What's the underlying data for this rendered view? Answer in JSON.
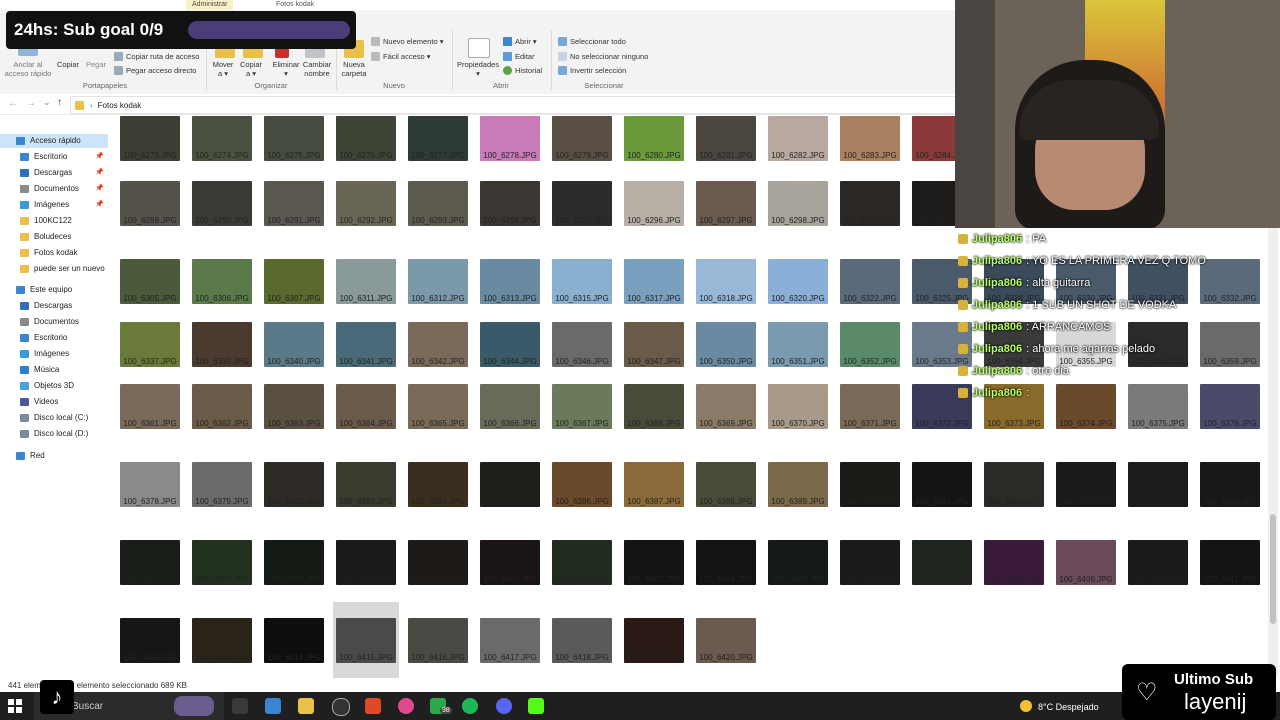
{
  "ribbon": {
    "tabs": [
      "Administrar",
      "Fotos kodak"
    ],
    "groups": {
      "portapapeles": "Portapapeles",
      "organizar": "Organizar",
      "nuevo": "Nuevo",
      "abrir": "Abrir",
      "seleccionar": "Seleccionar"
    },
    "buttons": {
      "anclar": [
        "Anclar al",
        "acceso rápido"
      ],
      "copiar": "Copiar",
      "pegar": "Pegar",
      "copiar_ruta": "Copiar ruta de acceso",
      "pegar_acceso": "Pegar acceso directo",
      "mover": [
        "Mover",
        "a ▾"
      ],
      "copiar_a": [
        "Copiar",
        "a ▾"
      ],
      "eliminar": [
        "Eliminar",
        "▾"
      ],
      "cambiar_nombre": [
        "Cambiar",
        "nombre"
      ],
      "nueva_carpeta": [
        "Nueva",
        "carpeta"
      ],
      "nuevo_elemento": "Nuevo elemento ▾",
      "facil_acceso": "Fácil acceso ▾",
      "propiedades": [
        "Propiedades",
        "▾"
      ],
      "abrir": "Abrir ▾",
      "editar": "Editar",
      "historial": "Historial",
      "seleccionar_todo": "Seleccionar todo",
      "no_seleccionar": "No seleccionar ninguno",
      "invertir": "Invertir selección"
    }
  },
  "address": {
    "path": "Fotos kodak"
  },
  "nav": {
    "items": [
      {
        "label": "Acceso rápido",
        "icon": "star-icon",
        "color": "#3a86d1",
        "level": 0,
        "selected": true,
        "pinned": false
      },
      {
        "label": "Escritorio",
        "icon": "desktop-icon",
        "color": "#3a86d1",
        "level": 1,
        "selected": false,
        "pinned": true
      },
      {
        "label": "Descargas",
        "icon": "download-icon",
        "color": "#2f6fbf",
        "level": 1,
        "selected": false,
        "pinned": true
      },
      {
        "label": "Documentos",
        "icon": "documents-icon",
        "color": "#8a8a8a",
        "level": 1,
        "selected": false,
        "pinned": true
      },
      {
        "label": "Imágenes",
        "icon": "pictures-icon",
        "color": "#3a9ad9",
        "level": 1,
        "selected": false,
        "pinned": true
      },
      {
        "label": "100KC122",
        "icon": "folder-icon",
        "color": "#e8c04a",
        "level": 1,
        "selected": false,
        "pinned": false
      },
      {
        "label": "Boludeces",
        "icon": "folder-icon",
        "color": "#e8c04a",
        "level": 1,
        "selected": false,
        "pinned": false
      },
      {
        "label": "Fotos kodak",
        "icon": "folder-icon",
        "color": "#e8c04a",
        "level": 1,
        "selected": false,
        "pinned": false
      },
      {
        "label": "puede ser un nuevo",
        "icon": "folder-icon",
        "color": "#e8c04a",
        "level": 1,
        "selected": false,
        "pinned": false
      },
      {
        "label": "Este equipo",
        "icon": "computer-icon",
        "color": "#3a86d1",
        "level": 0,
        "selected": false,
        "pinned": false
      },
      {
        "label": "Descargas",
        "icon": "download-icon",
        "color": "#2f6fbf",
        "level": 1,
        "selected": false,
        "pinned": false
      },
      {
        "label": "Documentos",
        "icon": "documents-icon",
        "color": "#8a8a8a",
        "level": 1,
        "selected": false,
        "pinned": false
      },
      {
        "label": "Escritorio",
        "icon": "desktop-icon",
        "color": "#3a86d1",
        "level": 1,
        "selected": false,
        "pinned": false
      },
      {
        "label": "Imágenes",
        "icon": "pictures-icon",
        "color": "#3a9ad9",
        "level": 1,
        "selected": false,
        "pinned": false
      },
      {
        "label": "Música",
        "icon": "music-icon",
        "color": "#2f7fd0",
        "level": 1,
        "selected": false,
        "pinned": false
      },
      {
        "label": "Objetos 3D",
        "icon": "3d-objects-icon",
        "color": "#4aa3df",
        "level": 1,
        "selected": false,
        "pinned": false
      },
      {
        "label": "Videos",
        "icon": "videos-icon",
        "color": "#4b5a9a",
        "level": 1,
        "selected": false,
        "pinned": false
      },
      {
        "label": "Disco local (C:)",
        "icon": "drive-icon",
        "color": "#7a8a9a",
        "level": 1,
        "selected": false,
        "pinned": false
      },
      {
        "label": "Disco local (D:)",
        "icon": "drive-icon",
        "color": "#7a8a9a",
        "level": 1,
        "selected": false,
        "pinned": false
      },
      {
        "label": "Red",
        "icon": "network-icon",
        "color": "#3a86d1",
        "level": 0,
        "selected": false,
        "pinned": false
      }
    ]
  },
  "files": {
    "rows": [
      [
        "100_6273.JPG",
        "100_6274.JPG",
        "100_6275.JPG",
        "100_6276.JPG",
        "100_6277.JPG",
        "100_6278.JPG",
        "100_6279.JPG",
        "100_6280.JPG",
        "100_6281.JPG",
        "100_6282.JPG",
        "100_6283.JPG",
        "100_6284.JPG"
      ],
      [
        "100_6289.JPG",
        "100_6290.JPG",
        "100_6291.JPG",
        "100_6292.JPG",
        "100_6293.JPG",
        "100_6294.JPG",
        "100_6295.JPG",
        "100_6296.JPG",
        "100_6297.JPG",
        "100_6298.JPG",
        "100_6299.JPG",
        "100_6300.JPG",
        "100_6301.JPG",
        "100_6302.JPG",
        "100_6303.JPG",
        "100_6304.JPG"
      ],
      [
        "100_6305.JPG",
        "100_6306.JPG",
        "100_6307.JPG",
        "100_6311.JPG",
        "100_6312.JPG",
        "100_6313.JPG",
        "100_6315.JPG",
        "100_6317.JPG",
        "100_6318.JPG",
        "100_6320.JPG",
        "100_6322.JPG",
        "100_6325.JPG",
        "100_6328.JPG",
        "100_6330.JPG",
        "100_6331.JPG",
        "100_6332.JPG"
      ],
      [
        "100_6337.JPG",
        "100_6339.JPG",
        "100_6340.JPG",
        "100_6341.JPG",
        "100_6342.JPG",
        "100_6344.JPG",
        "100_6346.JPG",
        "100_6347.JPG",
        "100_6350.JPG",
        "100_6351.JPG",
        "100_6352.JPG",
        "100_6353.JPG",
        "100_6354.JPG",
        "100_6355.JPG",
        "100_6356.JPG",
        "100_6359.JPG"
      ],
      [
        "100_6361.JPG",
        "100_6362.JPG",
        "100_6363.JPG",
        "100_6364.JPG",
        "100_6365.JPG",
        "100_6366.JPG",
        "100_6367.JPG",
        "100_6368.JPG",
        "100_6369.JPG",
        "100_6370.JPG",
        "100_6371.JPG",
        "100_6372.JPG",
        "100_6373.JPG",
        "100_6374.JPG",
        "100_6375.JPG",
        "100_6376.JPG"
      ],
      [
        "100_6378.JPG",
        "100_6379.JPG",
        "100_6382.JPG",
        "100_6383.JPG",
        "100_6384.JPG",
        "100_6385.JPG",
        "100_6386.JPG",
        "100_6387.JPG",
        "100_6388.JPG",
        "100_6389.JPG",
        "100_6390.JPG",
        "100_6391.JPG",
        "100_6392.JPG",
        "100_6393.JPG",
        "100_6394.JPG",
        "100_6395.JPG"
      ],
      [
        "100_6396.JPG",
        "100_6397.JPG",
        "100_6398.JPG",
        "100_6399.JPG",
        "100_6400.JPG",
        "100_6401.JPG",
        "100_6402.JPG",
        "100_6403.JPG",
        "100_6404.JPG",
        "100_6405.JPG",
        "100_6406.JPG",
        "100_6407.JPG",
        "100_6408.JPG",
        "100_6409.JPG",
        "100_6410.JPG",
        "100_6411.JPG"
      ],
      [
        "100_6412.JPG",
        "100_6413.JPG",
        "100_6414.JPG",
        "100_6415.JPG",
        "100_6416.JPG",
        "100_6417.JPG",
        "100_6418.JPG",
        "100_6419.JPG",
        "100_6420.JPG"
      ]
    ],
    "thumb_colors": [
      [
        "#3c3f34",
        "#4a5140",
        "#454b3e",
        "#3e4536",
        "#2e3a36",
        "#c97ab9",
        "#5a4f44",
        "#6a9a3a",
        "#4b4740",
        "#b9a8a0",
        "#a88060",
        "#8a3a3a"
      ],
      [
        "#54524a",
        "#3b3a36",
        "#5a5850",
        "#6a6656",
        "#5c5a4e",
        "#3a3632",
        "#2e2c2a",
        "#b8b0a6",
        "#6a5a50",
        "#a8a49c",
        "#2a2724",
        "#1e1c1a",
        "#20201e",
        "#2c2a28",
        "#2a2826",
        "#262422"
      ],
      [
        "#4a5a3a",
        "#5a7a4a",
        "#5a6a2e",
        "#8a9a9a",
        "#7a9aaa",
        "#6a8aa2",
        "#8ab0d0",
        "#7aa0c0",
        "#98b8d8",
        "#8ab0d8",
        "#5a6a7a",
        "#4a5a6a",
        "#3a4a5a",
        "#4a5a6a",
        "#405060",
        "#5a6a7a"
      ],
      [
        "#6a7a3a",
        "#4a3a30",
        "#5a7a8a",
        "#4a6a7a",
        "#7a6a5a",
        "#3a5a6a",
        "#6a6a6a",
        "#6a5a4a",
        "#6a8aa2",
        "#7a9ab0",
        "#5a8a6a",
        "#6a7a8a",
        "#3a3a3a",
        "#d8d8d8",
        "#2a2a2a",
        "#6a6a6a"
      ],
      [
        "#7a6a5a",
        "#6a5a48",
        "#5a5040",
        "#6a5a4a",
        "#7a6a58",
        "#6a6a5a",
        "#6a7a5a",
        "#4a4a3a",
        "#8a7a68",
        "#a89a88",
        "#7a6a58",
        "#3a3a5a",
        "#8a6a2a",
        "#6a4a2a",
        "#7a7a7a",
        "#4a4a6a"
      ],
      [
        "#8a8a88",
        "#6a6a6a",
        "#2e2a26",
        "#3a3a2e",
        "#3a2e1e",
        "#1e1e1a",
        "#6a4a2a",
        "#8a6a3a",
        "#4a4a3a",
        "#7a6a4a",
        "#1a1a16",
        "#141412",
        "#2a2a26",
        "#1a1a18",
        "#1c1c1a",
        "#181816"
      ],
      [
        "#1a1e18",
        "#22301e",
        "#141a14",
        "#1a1a1a",
        "#1e1a18",
        "#1a1416",
        "#202a1e",
        "#161412",
        "#141214",
        "#141818",
        "#1c1a18",
        "#1e241e",
        "#3a1a3a",
        "#6a4a5a",
        "#1a1a1a",
        "#141414"
      ],
      [
        "#161616",
        "#2a2418",
        "#0e0e0e",
        "#4a4a48",
        "#4a4a44",
        "#6a6a6a",
        "#5a5a5a",
        "#2a1a16",
        "#6a5a50"
      ]
    ],
    "selected": "100_6415.JPG"
  },
  "status": {
    "count": "441 elementos",
    "selection": "1 elemento seleccionado  689 KB"
  },
  "taskbar": {
    "search": "Buscar",
    "weather": "8°C  Despejado",
    "spotify_badge": "98"
  },
  "overlay": {
    "goal_text": "24hs: Sub goal 0/9",
    "goal_progress": 0.0,
    "chat": [
      {
        "user": "Julipa806",
        "msg": ": PA"
      },
      {
        "user": "Julipa806",
        "msg": ": YO ES LA PRIMERA VEZ Q TOMO"
      },
      {
        "user": "Julipa806",
        "msg": ": alta guitarra"
      },
      {
        "user": "Julipa806",
        "msg": ": 1 SUB UN SHOT DE VODKA"
      },
      {
        "user": "Julipa806",
        "msg": ": ARRANCAMOS"
      },
      {
        "user": "Julipa806",
        "msg": ": ahora me agarras pelado"
      },
      {
        "user": "Julipa806",
        "msg": ": otro dia"
      },
      {
        "user": "Julipa806",
        "msg": ":"
      }
    ],
    "last_sub_title": "Ultimo Sub",
    "last_sub_name": "layenij"
  },
  "colors": {
    "accent": "#3a86d1",
    "selected_nav": "#cce4f7",
    "chat_name": "#b6ff6a"
  }
}
